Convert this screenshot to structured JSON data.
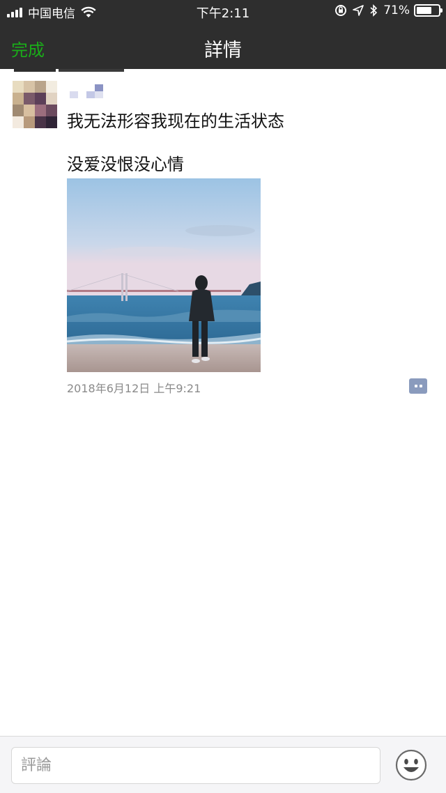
{
  "status_bar": {
    "carrier": "中国电信",
    "time": "下午2:11",
    "battery_percent": "71%",
    "battery_level": 0.71
  },
  "nav": {
    "done_label": "完成",
    "title": "詳情"
  },
  "post": {
    "lines": [
      "我无法形容我现在的生活状态",
      "没爱没恨没心情"
    ],
    "timestamp": "2018年6月12日 上午9:21"
  },
  "comment_bar": {
    "placeholder": "評論"
  },
  "colors": {
    "nav_background": "#2e2e2e",
    "accent_green": "#1aad19",
    "comment_button": "#8a9bbd"
  }
}
